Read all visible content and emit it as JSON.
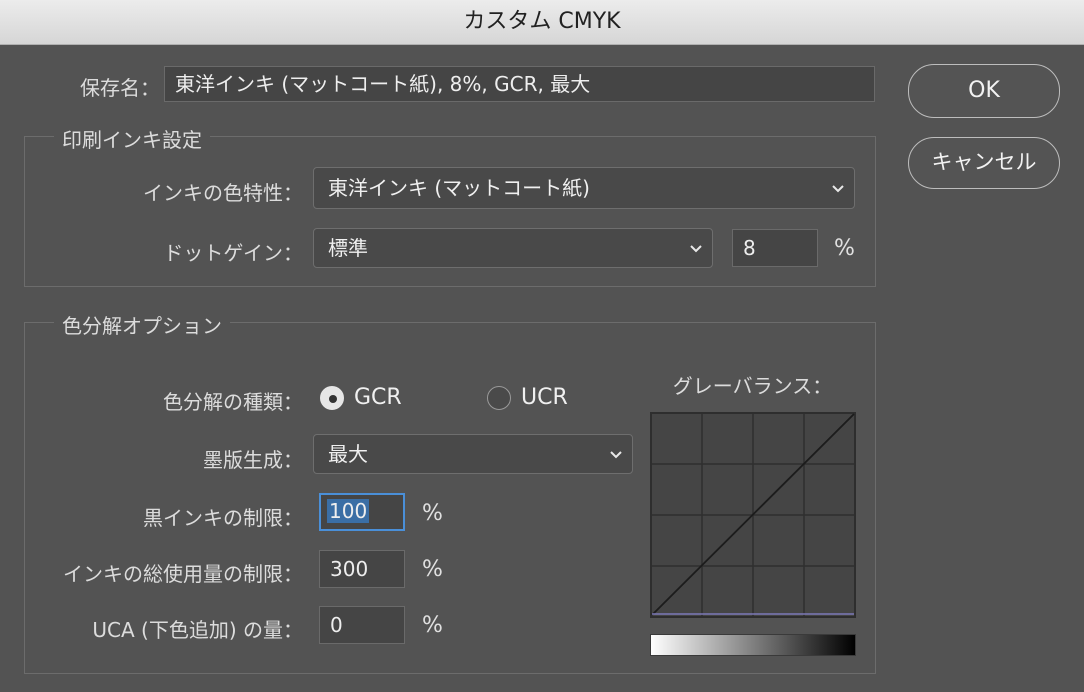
{
  "window": {
    "title": "カスタム CMYK"
  },
  "save_name": {
    "label": "保存名：",
    "value": "東洋インキ (マットコート紙), 8%, GCR, 最大"
  },
  "buttons": {
    "ok": "OK",
    "cancel": "キャンセル"
  },
  "ink_options": {
    "legend": "印刷インキ設定",
    "ink_colors_label": "インキの色特性：",
    "ink_colors_value": "東洋インキ (マットコート紙)",
    "dot_gain_label": "ドットゲイン：",
    "dot_gain_type": "標準",
    "dot_gain_value": "8",
    "dot_gain_unit": "%"
  },
  "separation_options": {
    "legend": "色分解オプション",
    "type_label": "色分解の種類：",
    "gcr_label": "GCR",
    "ucr_label": "UCR",
    "selected": "GCR",
    "black_generation_label": "墨版生成：",
    "black_generation_value": "最大",
    "black_ink_limit_label": "黒インキの制限：",
    "black_ink_limit_value": "100",
    "total_ink_limit_label": "インキの総使用量の制限：",
    "total_ink_limit_value": "300",
    "uca_label": "UCA (下色追加) の量：",
    "uca_value": "0",
    "percent": "%",
    "gray_ramp_label": "グレーバランス："
  }
}
